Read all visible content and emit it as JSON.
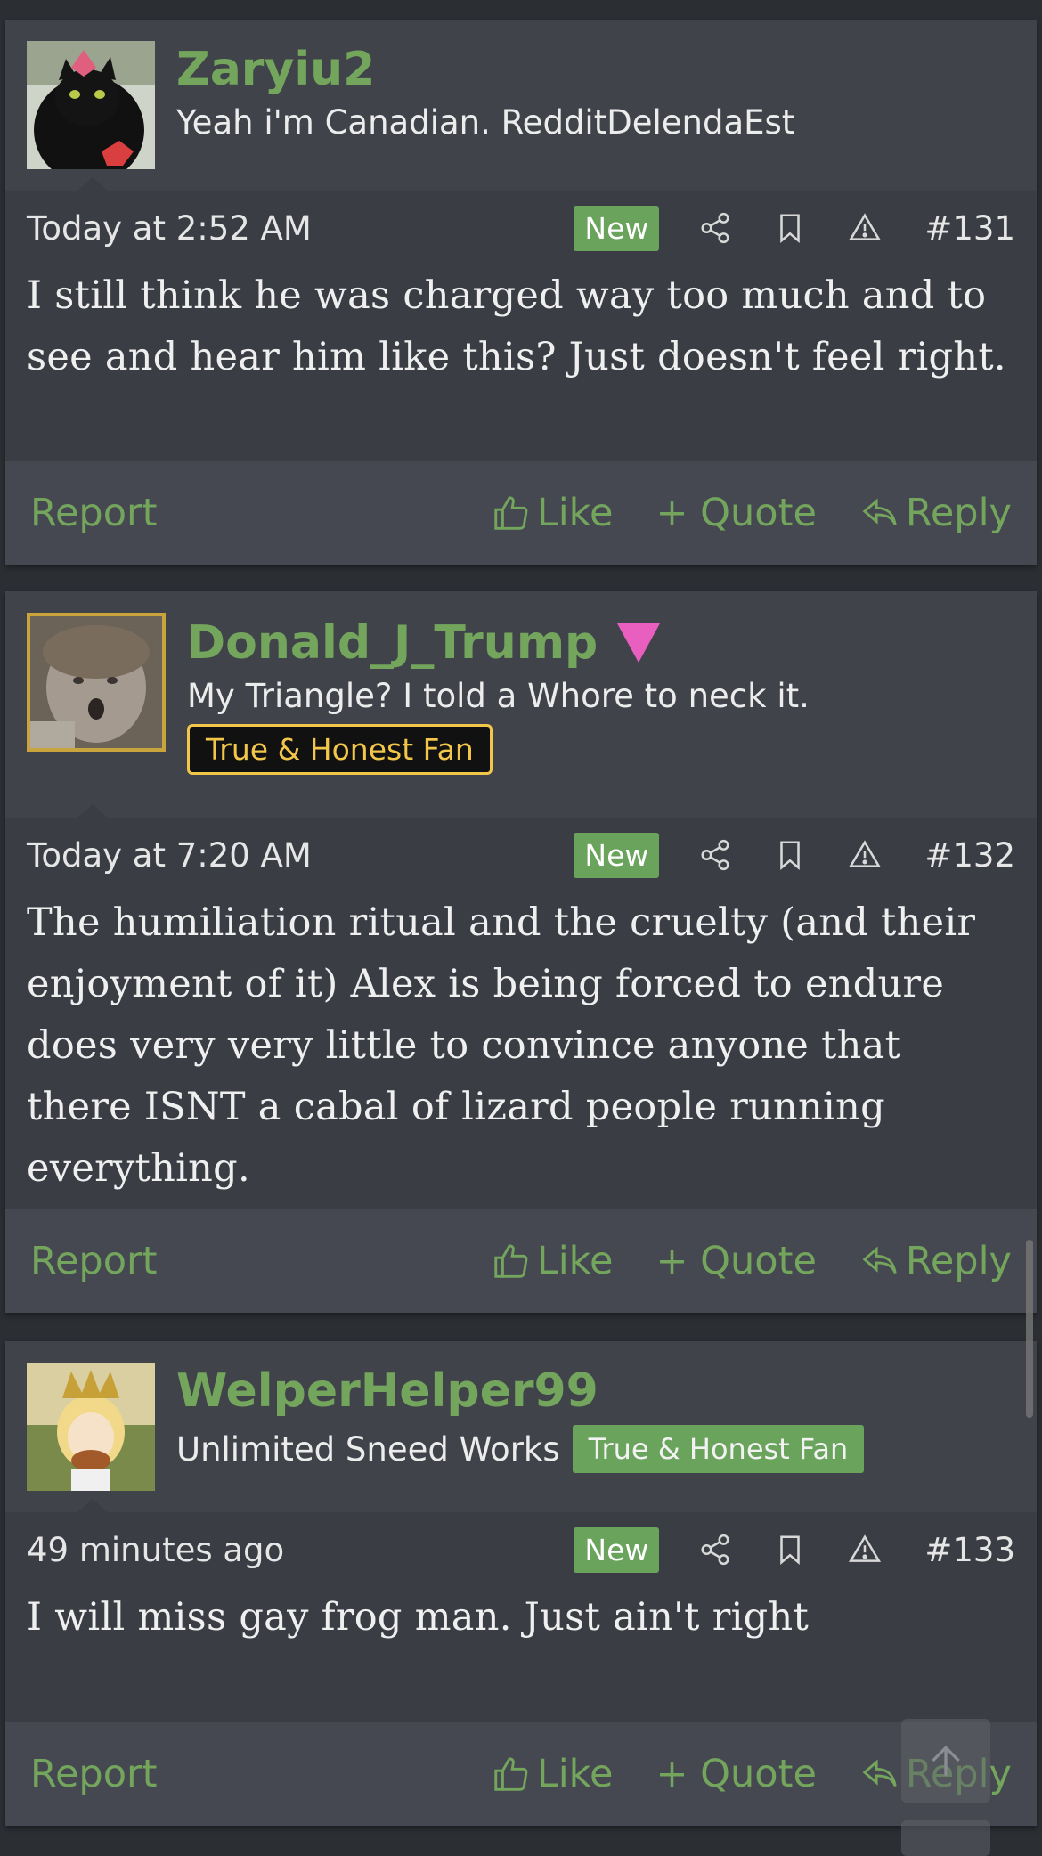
{
  "posts": [
    {
      "username": "Zaryiu2",
      "user_title": "Yeah i'm Canadian. RedditDelendaEst",
      "timestamp": "Today at 2:52 AM",
      "new_label": "New",
      "post_number": "#131",
      "body": "I still think he was charged way too much and to see and hear him like this? Just doesn't feel right."
    },
    {
      "username": "Donald_J_Trump",
      "user_title": "My Triangle? I told a Whore to neck it.",
      "banner": "True & Honest Fan",
      "timestamp": "Today at 7:20 AM",
      "new_label": "New",
      "post_number": "#132",
      "body": "The humiliation ritual and the cruelty (and their enjoyment of it) Alex is being forced to endure does very very little to convince anyone that there ISNT a cabal of lizard people running everything."
    },
    {
      "username": "WelperHelper99",
      "user_title": "Unlimited Sneed Works",
      "banner": "True & Honest Fan",
      "timestamp": "49 minutes ago",
      "new_label": "New",
      "post_number": "#133",
      "body": "I will miss gay frog man. Just ain't right"
    }
  ],
  "footer": {
    "report": "Report",
    "like": "Like",
    "quote": "+ Quote",
    "reply": "Reply"
  },
  "colors": {
    "accent_green": "#74a55d",
    "post_bg": "#3a3d44",
    "header_bg": "#40434a",
    "page_bg": "#2b2e33",
    "gold": "#f2c64a",
    "triangle_pink": "#e85fc0"
  },
  "icons": [
    "share-icon",
    "bookmark-icon",
    "warning-icon",
    "thumbs-up-icon",
    "reply-arrow-icon",
    "arrow-up-icon"
  ]
}
